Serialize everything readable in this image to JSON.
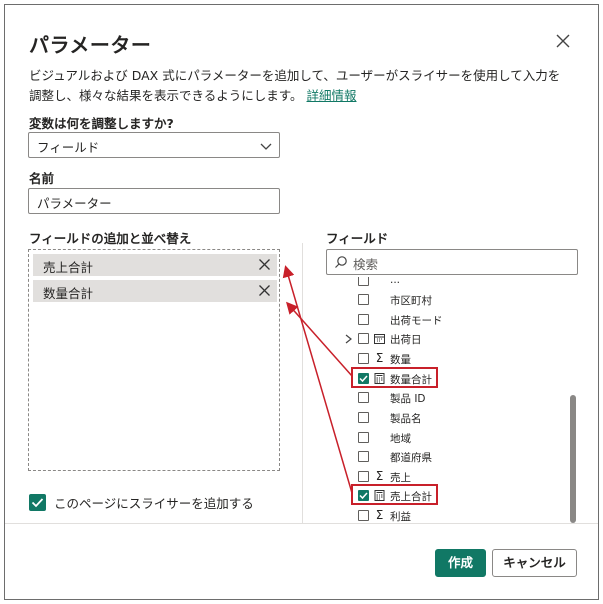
{
  "dialog": {
    "title": "パラメーター",
    "description": "ビジュアルおよび DAX 式にパラメーターを追加して、ユーザーがスライサーを使用して入力を調整し、様々な結果を表示できるようにします。",
    "details_link": "詳細情報"
  },
  "variable": {
    "label": "変数は何を調整しますか?",
    "selected": "フィールド"
  },
  "name": {
    "label": "名前",
    "value": "パラメーター"
  },
  "added_fields": {
    "label": "フィールドの追加と並べ替え",
    "items": [
      {
        "label": "売上合計"
      },
      {
        "label": "数量合計"
      }
    ]
  },
  "slicer_option": {
    "label": "このページにスライサーを追加する",
    "checked": true
  },
  "fields_panel": {
    "label": "フィールド",
    "search_placeholder": "検索",
    "items": [
      {
        "label": "...",
        "icon": "none",
        "checked": false,
        "expandable": false
      },
      {
        "label": "市区町村",
        "icon": "none",
        "checked": false,
        "expandable": false
      },
      {
        "label": "出荷モード",
        "icon": "none",
        "checked": false,
        "expandable": false
      },
      {
        "label": "出荷日",
        "icon": "calendar-icon",
        "checked": false,
        "expandable": true
      },
      {
        "label": "数量",
        "icon": "sigma-icon",
        "checked": false,
        "expandable": false
      },
      {
        "label": "数量合計",
        "icon": "measure-icon",
        "checked": true,
        "expandable": false
      },
      {
        "label": "製品 ID",
        "icon": "none",
        "checked": false,
        "expandable": false
      },
      {
        "label": "製品名",
        "icon": "none",
        "checked": false,
        "expandable": false
      },
      {
        "label": "地域",
        "icon": "none",
        "checked": false,
        "expandable": false
      },
      {
        "label": "都道府県",
        "icon": "none",
        "checked": false,
        "expandable": false
      },
      {
        "label": "売上",
        "icon": "sigma-icon",
        "checked": false,
        "expandable": false
      },
      {
        "label": "売上合計",
        "icon": "measure-icon",
        "checked": true,
        "expandable": false
      },
      {
        "label": "利益",
        "icon": "sigma-icon",
        "checked": false,
        "expandable": false
      }
    ]
  },
  "buttons": {
    "create": "作成",
    "cancel": "キャンセル"
  },
  "colors": {
    "accent": "#117865",
    "annotation": "#c8202a"
  }
}
